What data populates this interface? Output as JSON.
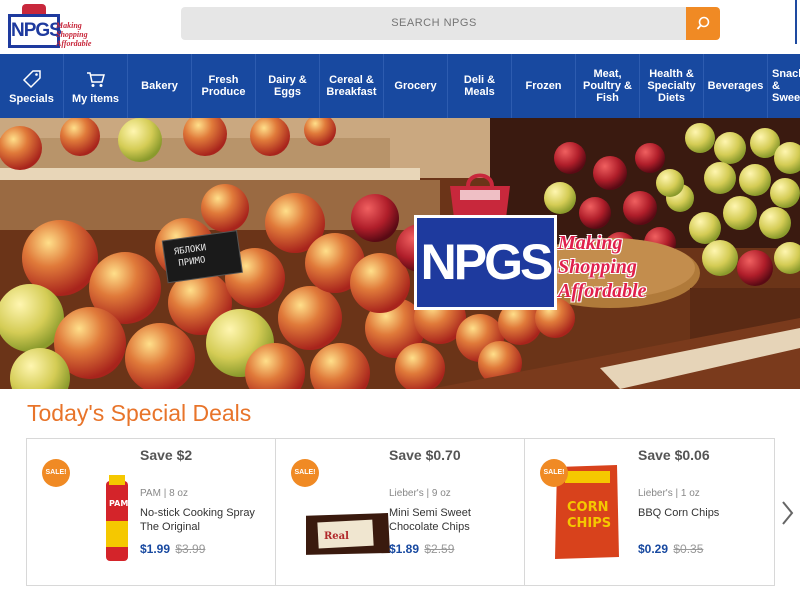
{
  "brand": {
    "logo_text": "NPGS",
    "tagline": "Making Shopping Affordable"
  },
  "search": {
    "placeholder": "SEARCH NPGS",
    "icon": "search-icon"
  },
  "nav": {
    "items": [
      {
        "label": "Specials",
        "icon": "tag-icon"
      },
      {
        "label": "My items",
        "icon": "cart-icon"
      },
      {
        "label": "Bakery"
      },
      {
        "label": "Fresh Produce"
      },
      {
        "label": "Dairy & Eggs"
      },
      {
        "label": "Cereal & Breakfast"
      },
      {
        "label": "Grocery"
      },
      {
        "label": "Deli & Meals"
      },
      {
        "label": "Frozen"
      },
      {
        "label": "Meat, Poultry & Fish"
      },
      {
        "label": "Health & Specialty Diets"
      },
      {
        "label": "Beverages"
      },
      {
        "label": "Snacks & Sweets"
      }
    ]
  },
  "hero": {
    "logo_text": "NPGS",
    "tagline": "Making Shopping Affordable"
  },
  "deals_section": {
    "title": "Today's Special Deals",
    "badge": "SALE!",
    "deals": [
      {
        "save": "Save $2",
        "meta": "PAM | 8 oz",
        "name": "No-stick Cooking Spray The Original",
        "price": "$1.99",
        "was": "$3.99"
      },
      {
        "save": "Save $0.70",
        "meta": "Lieber's | 9 oz",
        "name": "Mini Semi Sweet Chocolate Chips",
        "price": "$1.89",
        "was": "$2.59"
      },
      {
        "save": "Save $0.06",
        "meta": "Lieber's | 1 oz",
        "name": "BBQ Corn Chips",
        "price": "$0.29",
        "was": "$0.35"
      }
    ]
  },
  "colors": {
    "nav": "#1849a0",
    "accent": "#f08a24",
    "title": "#e8742a",
    "price": "#1849a0"
  }
}
